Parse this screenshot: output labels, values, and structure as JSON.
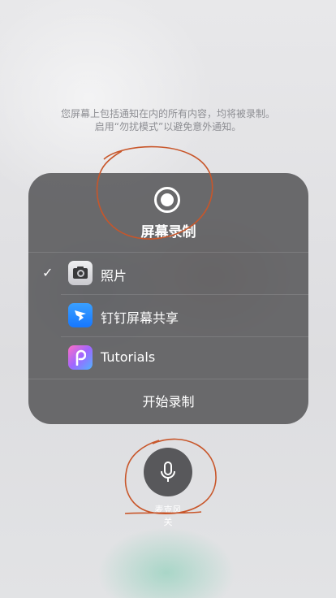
{
  "notice": {
    "line1": "您屏幕上包括通知在内的所有内容，均将被录制。",
    "line2": "启用“勿扰模式”以避免意外通知。"
  },
  "panel": {
    "title": "屏幕录制",
    "options": [
      {
        "label": "照片",
        "icon": "photos-icon",
        "selected": true
      },
      {
        "label": "钉钉屏幕共享",
        "icon": "dingtalk-icon",
        "selected": false
      },
      {
        "label": "Tutorials",
        "icon": "picsart-icon",
        "selected": false
      }
    ],
    "check_glyph": "✓",
    "start_label": "开始录制"
  },
  "mic": {
    "line1": "麦克风",
    "line2": "关"
  },
  "colors": {
    "annotation": "#c8562a",
    "panel": "#606062"
  }
}
